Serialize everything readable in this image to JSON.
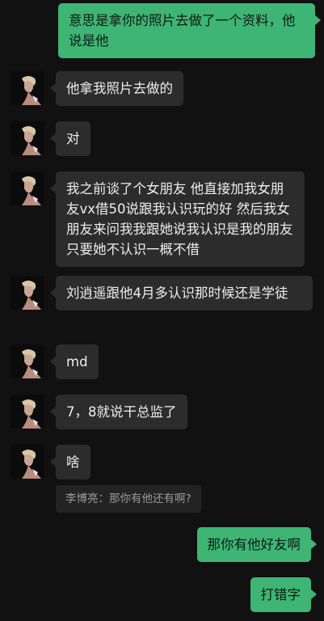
{
  "messages": [
    {
      "side": "out",
      "text": "意思是拿你的照片去做了一个资料，他说是他"
    },
    {
      "side": "in",
      "text": "他拿我照片去做的"
    },
    {
      "side": "in",
      "text": "对"
    },
    {
      "side": "in",
      "text": "我之前谈了个女朋友 他直接加我女朋友vx借50说跟我认识玩的好 然后我女朋友来问我我跟她说我认识是我的朋友只要她不认识一概不借"
    },
    {
      "side": "in",
      "text": "刘逍遥跟他4月多认识那时候还是学徒"
    },
    {
      "side": "in",
      "text": "md"
    },
    {
      "side": "in",
      "text": "7，8就说干总监了"
    },
    {
      "side": "in",
      "text": "啥"
    },
    {
      "side": "out",
      "text": "那你有他好友啊"
    },
    {
      "side": "out",
      "text": "打错字"
    }
  ],
  "quoted_reply": "李博亮：那你有他还有啊?",
  "colors": {
    "background": "#111111",
    "incoming_bubble": "#2c2c2c",
    "outgoing_bubble": "#3eb575"
  }
}
